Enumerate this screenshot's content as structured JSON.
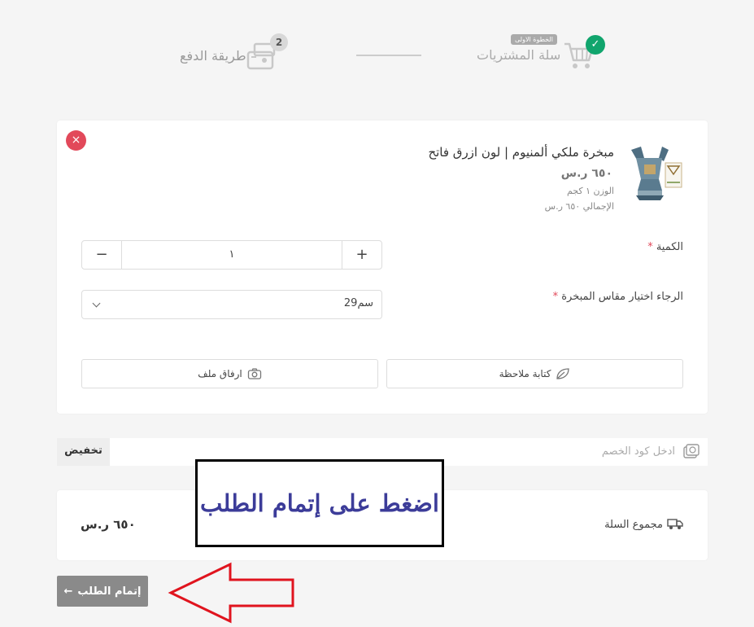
{
  "stepper": {
    "step1": {
      "badge": "الخطوة الاولى",
      "label": "سلة المشتريات",
      "status": "done"
    },
    "step2": {
      "number": "2",
      "label": "طريقة الدفع"
    }
  },
  "product": {
    "name": "مبخرة ملكي ألمنيوم | لون ازرق فاتح",
    "price": "٦٥٠ ر.س",
    "weight": "الوزن ١ كجم",
    "total": "الإجمالي ٦٥٠ ر.س",
    "remove_icon": "×"
  },
  "quantity": {
    "label": "الكمية",
    "required_mark": "*",
    "value": "١",
    "plus": "+",
    "minus": "−"
  },
  "size_option": {
    "label": "الرجاء اختيار مقاس المبخرة",
    "required_mark": "*",
    "selected": "29سم"
  },
  "actions": {
    "note": "كتابة ملاحظة",
    "attach": "ارفاق ملف"
  },
  "coupon": {
    "placeholder": "ادخل كود الخصم",
    "button": "تخفيض"
  },
  "totals": {
    "label": "مجموع السلة",
    "value": "٦٥٠ ر.س"
  },
  "annotation": {
    "text": "اضغط على إتمام الطلب"
  },
  "checkout": {
    "label": "إتمام الطلب",
    "arrow": "←"
  },
  "colors": {
    "success": "#11a56d",
    "danger": "#e2495a",
    "button_gray": "#8a8a8a",
    "annotation_blue": "#3c3c99",
    "arrow_red": "#e0141e"
  }
}
